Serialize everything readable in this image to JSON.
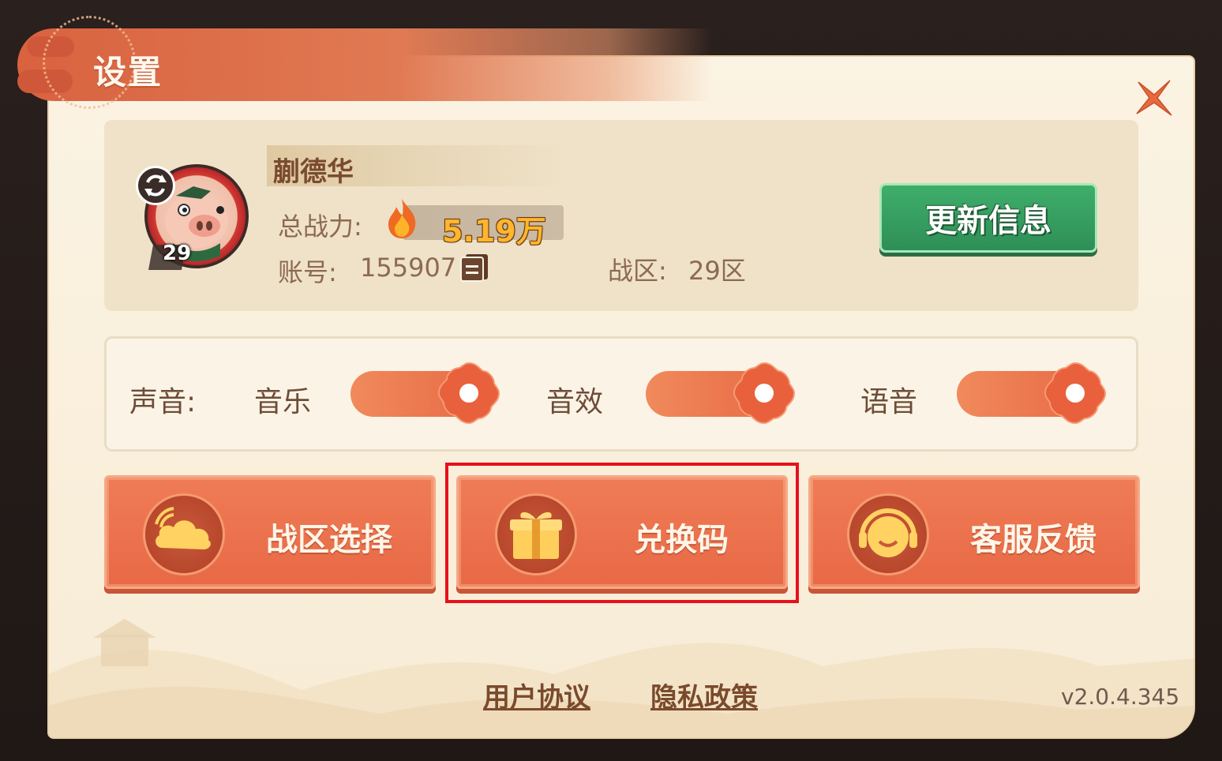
{
  "dialog": {
    "title": "设置"
  },
  "profile": {
    "name": "蒯德华",
    "level": "29",
    "power_label": "总战力:",
    "power_value": "5.19万",
    "account_label": "账号:",
    "account_value": "155907",
    "server_label": "战区:",
    "server_value": "29区",
    "update_button": "更新信息"
  },
  "sound": {
    "label": "声音:",
    "toggles": [
      {
        "label": "音乐",
        "on": true
      },
      {
        "label": "音效",
        "on": true
      },
      {
        "label": "语音",
        "on": true
      }
    ]
  },
  "actions": [
    {
      "label": "战区选择",
      "icon": "cloud-icon"
    },
    {
      "label": "兑换码",
      "icon": "gift-icon"
    },
    {
      "label": "客服反馈",
      "icon": "headset-icon"
    }
  ],
  "footer": {
    "user_agreement": "用户协议",
    "privacy_policy": "隐私政策",
    "version": "v2.0.4.345"
  },
  "colors": {
    "accent": "#e86a45",
    "update_button": "#3fae6b",
    "highlight": "#e8101a"
  }
}
